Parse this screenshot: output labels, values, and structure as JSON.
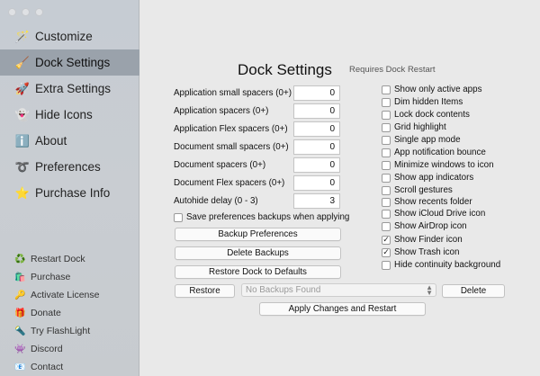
{
  "sidebar": {
    "items": [
      {
        "label": "Customize",
        "icon": "wand-icon",
        "glyph": "🪄"
      },
      {
        "label": "Dock Settings",
        "icon": "broom-icon",
        "glyph": "🧹",
        "active": true
      },
      {
        "label": "Extra Settings",
        "icon": "rocket-icon",
        "glyph": "🚀"
      },
      {
        "label": "Hide Icons",
        "icon": "ghost-icon",
        "glyph": "👻"
      },
      {
        "label": "About",
        "icon": "info-icon",
        "glyph": "ℹ️"
      },
      {
        "label": "Preferences",
        "icon": "dotted-arrow-icon",
        "glyph": "➰"
      },
      {
        "label": "Purchase Info",
        "icon": "star-icon",
        "glyph": "⭐"
      }
    ],
    "links": [
      {
        "label": "Restart Dock",
        "icon": "recycle-icon",
        "glyph": "♻️"
      },
      {
        "label": "Purchase",
        "icon": "shopping-bag-icon",
        "glyph": "🛍️"
      },
      {
        "label": "Activate License",
        "icon": "key-icon",
        "glyph": "🔑"
      },
      {
        "label": "Donate",
        "icon": "gift-icon",
        "glyph": "🎁"
      },
      {
        "label": "Try FlashLight",
        "icon": "flashlight-icon",
        "glyph": "🔦"
      },
      {
        "label": "Discord",
        "icon": "discord-icon",
        "glyph": "👾"
      },
      {
        "label": "Contact",
        "icon": "envelope-icon",
        "glyph": "📧"
      }
    ]
  },
  "main": {
    "title": "Dock Settings",
    "subtitle": "Requires Dock Restart",
    "fields": [
      {
        "label": "Application small spacers (0+)",
        "value": "0"
      },
      {
        "label": "Application spacers (0+)",
        "value": "0"
      },
      {
        "label": "Application Flex spacers (0+)",
        "value": "0"
      },
      {
        "label": "Document small spacers (0+)",
        "value": "0"
      },
      {
        "label": "Document spacers (0+)",
        "value": "0"
      },
      {
        "label": "Document Flex spacers (0+)",
        "value": "0"
      },
      {
        "label": "Autohide delay (0 - 3)",
        "value": "3"
      }
    ],
    "save_backups_label": "Save preferences backups when applying",
    "save_backups_checked": false,
    "options": [
      {
        "label": "Show only active apps",
        "checked": false
      },
      {
        "label": "Dim hidden Items",
        "checked": false
      },
      {
        "label": "Lock dock contents",
        "checked": false
      },
      {
        "label": "Grid highlight",
        "checked": false
      },
      {
        "label": "Single app mode",
        "checked": false
      },
      {
        "label": "App notification bounce",
        "checked": false
      },
      {
        "label": "Minimize windows to icon",
        "checked": false
      },
      {
        "label": "Show app indicators",
        "checked": false
      },
      {
        "label": "Scroll gestures",
        "checked": false
      },
      {
        "label": "Show recents folder",
        "checked": false
      },
      {
        "label": "Show iCloud Drive icon",
        "checked": false
      },
      {
        "label": "Show AirDrop icon",
        "checked": false
      },
      {
        "label": "Show Finder icon",
        "checked": true
      },
      {
        "label": "Show Trash icon",
        "checked": true
      },
      {
        "label": "Hide continuity background",
        "checked": false
      }
    ],
    "buttons": {
      "backup": "Backup Preferences",
      "delete_backups": "Delete Backups",
      "restore_defaults": "Restore Dock to Defaults",
      "restore": "Restore",
      "backup_select": "No Backups Found",
      "delete": "Delete",
      "apply": "Apply Changes and Restart"
    }
  }
}
